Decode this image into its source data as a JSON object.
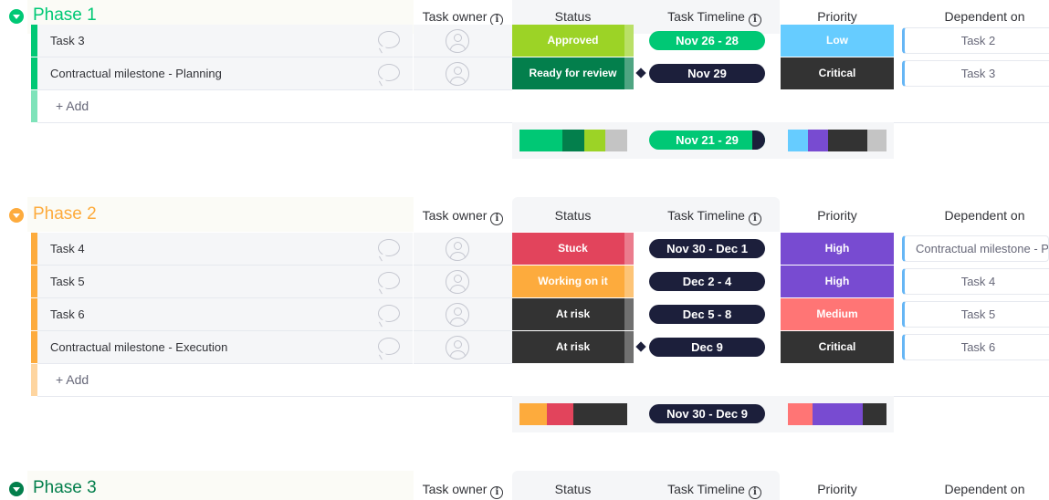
{
  "columns": {
    "owner": "Task owner",
    "status": "Status",
    "timeline": "Task Timeline",
    "priority": "Priority",
    "dependent": "Dependent on",
    "info": "i"
  },
  "add_label": "+ Add",
  "groups": [
    {
      "title": "Phase 1",
      "color": "#00c875",
      "rows": [
        {
          "name": "Task 3",
          "status": "Approved",
          "status_color": "#9cd326",
          "timeline": "Nov 26 - 28",
          "timeline_color": "#00c875",
          "priority": "Low",
          "priority_color": "#66ccff",
          "dependent": "Task 2"
        },
        {
          "name": "Contractual milestone - Planning",
          "status": "Ready for review",
          "status_color": "#037f4c",
          "timeline": "Nov 29",
          "timeline_color": "#1c1f3b",
          "priority": "Critical",
          "priority_color": "#333333",
          "dependent": "Task 3"
        }
      ],
      "summary_timeline": "Nov 21 - 29"
    },
    {
      "title": "Phase 2",
      "color": "#fdab3d",
      "rows": [
        {
          "name": "Task 4",
          "status": "Stuck",
          "status_color": "#e2445c",
          "timeline": "Nov 30 - Dec 1",
          "timeline_color": "#1c1f3b",
          "priority": "High",
          "priority_color": "#784bd1",
          "dependent": "Contractual milestone - P"
        },
        {
          "name": "Task 5",
          "status": "Working on it",
          "status_color": "#fdab3d",
          "timeline": "Dec 2 - 4",
          "timeline_color": "#1c1f3b",
          "priority": "High",
          "priority_color": "#784bd1",
          "dependent": "Task 4"
        },
        {
          "name": "Task 6",
          "status": "At risk",
          "status_color": "#333333",
          "timeline": "Dec 5 - 8",
          "timeline_color": "#1c1f3b",
          "priority": "Medium",
          "priority_color": "#ff7575",
          "dependent": "Task 5"
        },
        {
          "name": "Contractual milestone - Execution",
          "status": "At risk",
          "status_color": "#333333",
          "timeline": "Dec 9",
          "timeline_color": "#1c1f3b",
          "priority": "Critical",
          "priority_color": "#333333",
          "dependent": "Task 6"
        }
      ],
      "summary_timeline": "Nov 30 - Dec 9"
    },
    {
      "title": "Phase 3",
      "color": "#037f4c"
    }
  ]
}
